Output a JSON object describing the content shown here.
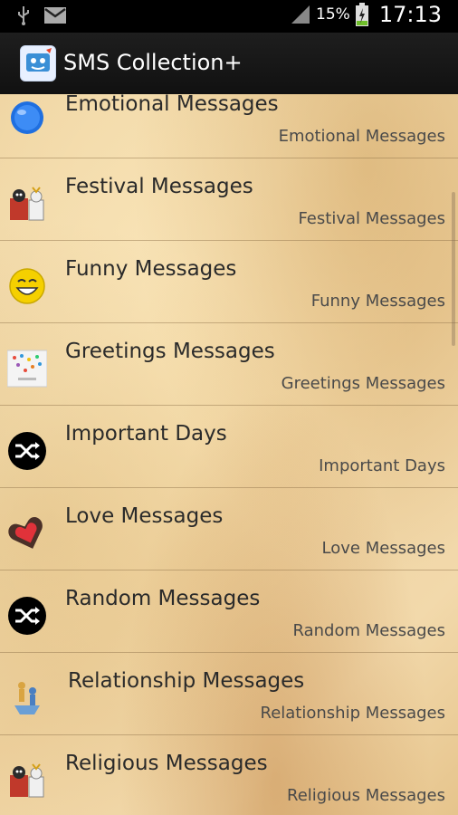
{
  "status": {
    "battery_percent": "15%",
    "time": "17:13"
  },
  "app": {
    "title": "SMS Collection+"
  },
  "items": [
    {
      "title": "Emotional Messages",
      "subtitle": "Emotional Messages",
      "icon": "emotional-icon"
    },
    {
      "title": "Festival Messages",
      "subtitle": "Festival Messages",
      "icon": "festival-icon"
    },
    {
      "title": "Funny Messages",
      "subtitle": "Funny Messages",
      "icon": "funny-smiley-icon"
    },
    {
      "title": "Greetings Messages",
      "subtitle": "Greetings Messages",
      "icon": "greetings-card-icon"
    },
    {
      "title": "Important Days",
      "subtitle": "Important Days",
      "icon": "shuffle-icon"
    },
    {
      "title": "Love Messages",
      "subtitle": "Love Messages",
      "icon": "heart-icon"
    },
    {
      "title": "Random Messages",
      "subtitle": "Random Messages",
      "icon": "shuffle-icon"
    },
    {
      "title": "Relationship Messages",
      "subtitle": "Relationship Messages",
      "icon": "relationship-icon"
    },
    {
      "title": "Religious Messages",
      "subtitle": "Religious Messages",
      "icon": "religious-icon"
    }
  ],
  "colors": {
    "status_bar": "#000000",
    "app_bar": "#161616",
    "parchment": "#f0d6a4"
  }
}
